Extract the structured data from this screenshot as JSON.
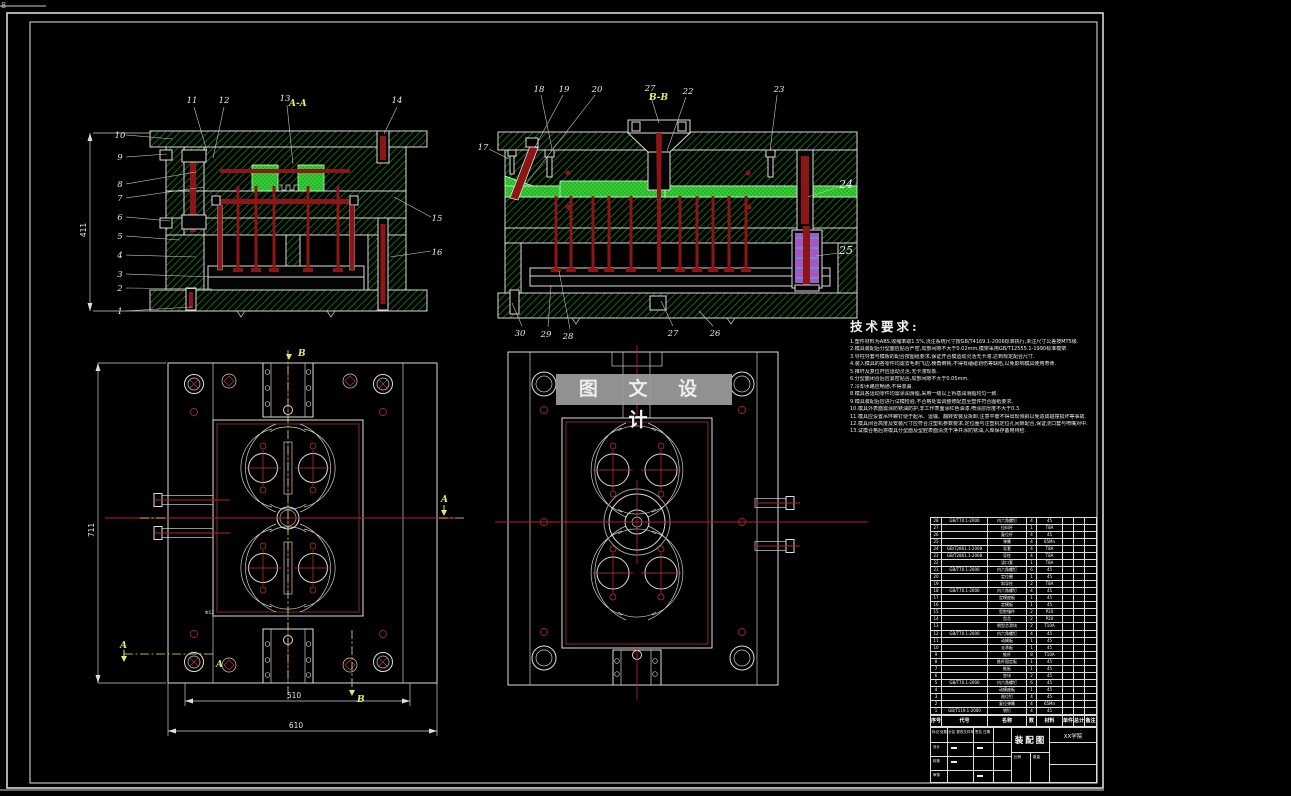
{
  "sheet": {
    "mark": "8"
  },
  "aa": {
    "label": "A-A",
    "dim": "411",
    "callouts": [
      "1",
      "2",
      "3",
      "4",
      "5",
      "6",
      "7",
      "8",
      "9",
      "10",
      "11",
      "12",
      "13",
      "14",
      "15",
      "16"
    ]
  },
  "bb": {
    "label": "B-B",
    "callouts": [
      "17",
      "18",
      "19",
      "20",
      "27",
      "22",
      "23",
      "24",
      "25",
      "30",
      "29",
      "28",
      "27",
      "26"
    ]
  },
  "pl": {
    "d510": "510",
    "d610": "610",
    "d711": "711",
    "hole": "Φ12",
    "A": "A",
    "B": "B"
  },
  "pr": {
    "watermark": "图 文 设 计"
  },
  "tech": {
    "title": "技术要求:",
    "lines": [
      "1.塑件材料为ABS,收缩率取1.5%,浇注系统尺寸按GB/T4169.1-2006标准执行,未注尺寸公差按MT5级.",
      "2.模具装配后分型面应贴合严密,局部间隙不大于0.02mm,模架采用GB/T12555.1-1990标准模架.",
      "3.导柱导套与模板的配合按图纸要求,保证开合模运动灵活无卡滞,达到规定配合尺寸.",
      "4.装入模具的各零件均需去毛刺飞边,棱角倒钝,不得有磕碰划伤等缺陷,以免影响模具使用寿命.",
      "5.推杆及复位杆应运动灵活,无卡滞现象.",
      "6.分型面闭合后应紧密贴合,局部间隙不大于0.05mm.",
      "7.冷却水路应畅通,不得渗漏.",
      "8.模具各运动零件均需涂润滑脂,采用一级以上钙基润滑脂均匀一致.",
      "9.模具装配后应进行试模检验,不合格处需调整修配直至塑件符合图纸要求.",
      "10.模具外表面需涂防锈油防护,非工作表面涂红色油漆,喷涂层厚度不大于0.3.",
      "11.模具应设置吊环螺钉便于起吊、运输、翻转安装及拆卸,注意平衡不得出现倾斜以免造成碰撞损坏等事故.",
      "12.模具闭合高度及安装尺寸应符合注塑机参数要求,定位圈与注塑机定位孔间隙配合,保证浇口套与喷嘴对中.",
      "13.试模合格后将模具分型面及型腔表面清洗干净并涂防锈油,入库保存备用待检."
    ]
  },
  "bom": {
    "headers": [
      "序号",
      "代号",
      "名称",
      "数量",
      "材料",
      "单件",
      "总计",
      "备注"
    ],
    "rows": [
      {
        "n": "28",
        "c": "GB/T70.1-2000",
        "m": "内六角螺钉",
        "q": "4",
        "t": "45"
      },
      {
        "n": "27",
        "c": "",
        "m": "拉料杆",
        "q": "1",
        "t": "T8A"
      },
      {
        "n": "26",
        "c": "",
        "m": "复位杆",
        "q": "4",
        "t": "45"
      },
      {
        "n": "25",
        "c": "",
        "m": "弹簧",
        "q": "4",
        "t": "65Mn"
      },
      {
        "n": "24",
        "c": "GB/T2861.1-2008",
        "m": "导套",
        "q": "4",
        "t": "T8A"
      },
      {
        "n": "23",
        "c": "GB/T2861.1-2008",
        "m": "导柱",
        "q": "4",
        "t": "T8A"
      },
      {
        "n": "22",
        "c": "",
        "m": "浇口套",
        "q": "1",
        "t": "T8A"
      },
      {
        "n": "21",
        "c": "GB/T70.1-2000",
        "m": "内六角螺钉",
        "q": "6",
        "t": "45"
      },
      {
        "n": "20",
        "c": "",
        "m": "定位圈",
        "q": "1",
        "t": "45"
      },
      {
        "n": "19",
        "c": "",
        "m": "斜导柱",
        "q": "2",
        "t": "T8A"
      },
      {
        "n": "18",
        "c": "GB/T70.1-2000",
        "m": "内六角螺钉",
        "q": "4",
        "t": "45"
      },
      {
        "n": "17",
        "c": "",
        "m": "定模座板",
        "q": "1",
        "t": "45"
      },
      {
        "n": "16",
        "c": "",
        "m": "定模板",
        "q": "1",
        "t": "45"
      },
      {
        "n": "15",
        "c": "",
        "m": "型腔镶件",
        "q": "2",
        "t": "P20"
      },
      {
        "n": "14",
        "c": "",
        "m": "型芯",
        "q": "2",
        "t": "P20"
      },
      {
        "n": "13",
        "c": "",
        "m": "侧型芯滑块",
        "q": "2",
        "t": "T10A"
      },
      {
        "n": "12",
        "c": "GB/T70.1-2000",
        "m": "内六角螺钉",
        "q": "4",
        "t": "45"
      },
      {
        "n": "11",
        "c": "",
        "m": "动模板",
        "q": "1",
        "t": "45"
      },
      {
        "n": "10",
        "c": "",
        "m": "支承板",
        "q": "1",
        "t": "45"
      },
      {
        "n": "9",
        "c": "",
        "m": "推杆",
        "q": "8",
        "t": "T10A"
      },
      {
        "n": "8",
        "c": "",
        "m": "推杆固定板",
        "q": "1",
        "t": "45"
      },
      {
        "n": "7",
        "c": "",
        "m": "推板",
        "q": "1",
        "t": "45"
      },
      {
        "n": "6",
        "c": "",
        "m": "垫块",
        "q": "2",
        "t": "45"
      },
      {
        "n": "5",
        "c": "GB/T70.1-2000",
        "m": "内六角螺钉",
        "q": "6",
        "t": "45"
      },
      {
        "n": "4",
        "c": "",
        "m": "动模座板",
        "q": "1",
        "t": "45"
      },
      {
        "n": "3",
        "c": "",
        "m": "限位钉",
        "q": "4",
        "t": "45"
      },
      {
        "n": "2",
        "c": "",
        "m": "复位弹簧",
        "q": "4",
        "t": "65Mn"
      },
      {
        "n": "1",
        "c": "GB/T119.1-2000",
        "m": "销钉",
        "q": "4",
        "t": "45"
      }
    ]
  },
  "tb": {
    "title": "装配图",
    "org": "XX学院",
    "row_top": "标记 处数 分区 更改文件号 签名 日期",
    "design": "设计",
    "check": "校核",
    "review": "审核",
    "scale_label": "比例",
    "qty_label": "数量"
  }
}
